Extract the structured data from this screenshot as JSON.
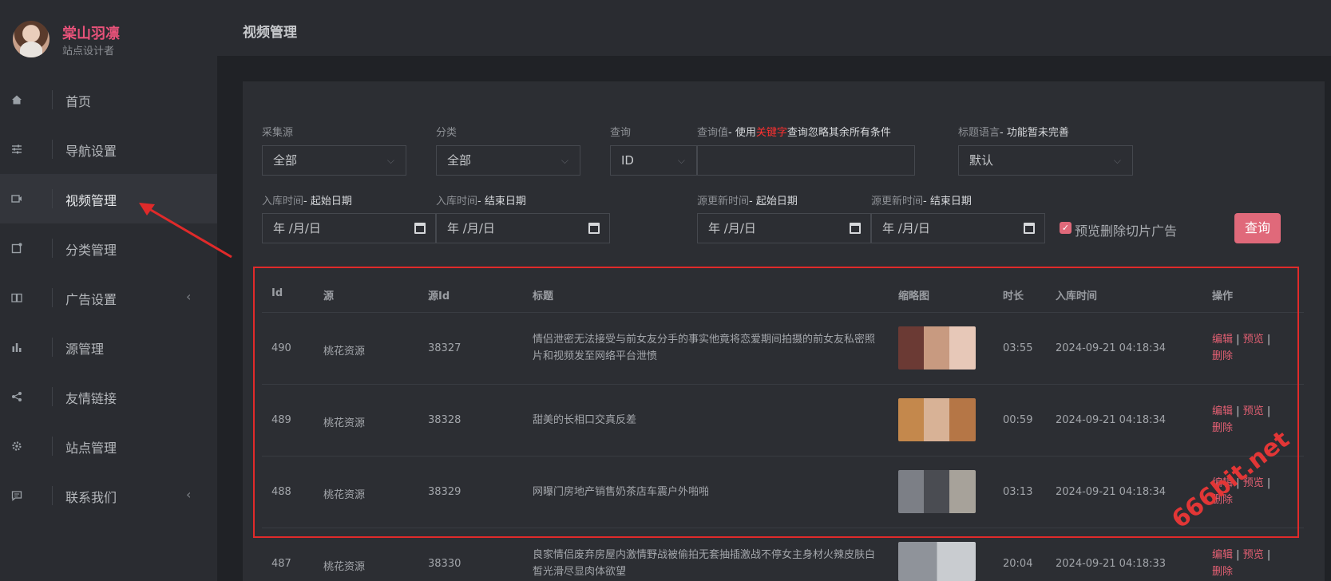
{
  "profile": {
    "name": "棠山羽凛",
    "role": "站点设计者"
  },
  "nav": [
    {
      "label": "首页",
      "icon": "home-icon"
    },
    {
      "label": "导航设置",
      "icon": "sliders-icon"
    },
    {
      "label": "视频管理",
      "icon": "video-icon",
      "active": true
    },
    {
      "label": "分类管理",
      "icon": "category-icon"
    },
    {
      "label": "广告设置",
      "icon": "book-icon",
      "caret": "‹"
    },
    {
      "label": "源管理",
      "icon": "bar-chart-icon"
    },
    {
      "label": "友情链接",
      "icon": "share-icon"
    },
    {
      "label": "站点管理",
      "icon": "gear-icon"
    },
    {
      "label": "联系我们",
      "icon": "message-icon",
      "caret": "‹"
    }
  ],
  "header": {
    "title": "视频管理"
  },
  "filters": {
    "source_label": "采集源",
    "source_value": "全部",
    "category_label": "分类",
    "category_value": "全部",
    "query_label": "查询",
    "query_value": "ID",
    "query_value_label_prefix": "查询值",
    "query_value_label_dash": "- 使用",
    "query_value_label_keyword": "关键字",
    "query_value_label_suffix": "查询忽略其余所有条件",
    "query_input": "",
    "lang_label": "标题语言",
    "lang_note": "- 功能暂未完善",
    "lang_value": "默认",
    "in_time_label": "入库时间",
    "start_note": "- 起始日期",
    "end_note": "- 结束日期",
    "src_time_label": "源更新时间",
    "date_placeholder": "年 /月/日",
    "checkbox_label": "预览删除切片广告",
    "query_button": "查询"
  },
  "table": {
    "headers": [
      "Id",
      "源",
      "源Id",
      "标题",
      "缩略图",
      "时长",
      "入库时间",
      "操作"
    ],
    "ops": {
      "edit": "编辑",
      "preview": "预览",
      "delete": "删除",
      "sep": "|"
    },
    "rows": [
      {
        "id": "490",
        "source": "桃花资源",
        "source_id": "38327",
        "title": "情侣泄密无法接受与前女友分手的事实他竟将恋爱期间拍摄的前女友私密照片和视频发至网络平台泄愤",
        "duration": "03:55",
        "time": "2024-09-21 04:18:34"
      },
      {
        "id": "489",
        "source": "桃花资源",
        "source_id": "38328",
        "title": "甜美的长相口交真反差",
        "duration": "00:59",
        "time": "2024-09-21 04:18:34"
      },
      {
        "id": "488",
        "source": "桃花资源",
        "source_id": "38329",
        "title": "网曝门房地产销售奶茶店车震户外啪啪",
        "duration": "03:13",
        "time": "2024-09-21 04:18:34"
      },
      {
        "id": "487",
        "source": "桃花资源",
        "source_id": "38330",
        "title": "良家情侣废弃房屋内激情野战被偷拍无套抽插激战不停女主身材火辣皮肤白皙光滑尽显肉体欲望",
        "duration": "20:04",
        "time": "2024-09-21 04:18:33"
      }
    ]
  },
  "watermark": "666bit.net",
  "colors": {
    "accent": "#e0697a",
    "link": "#e46073",
    "name": "#e8527a"
  }
}
